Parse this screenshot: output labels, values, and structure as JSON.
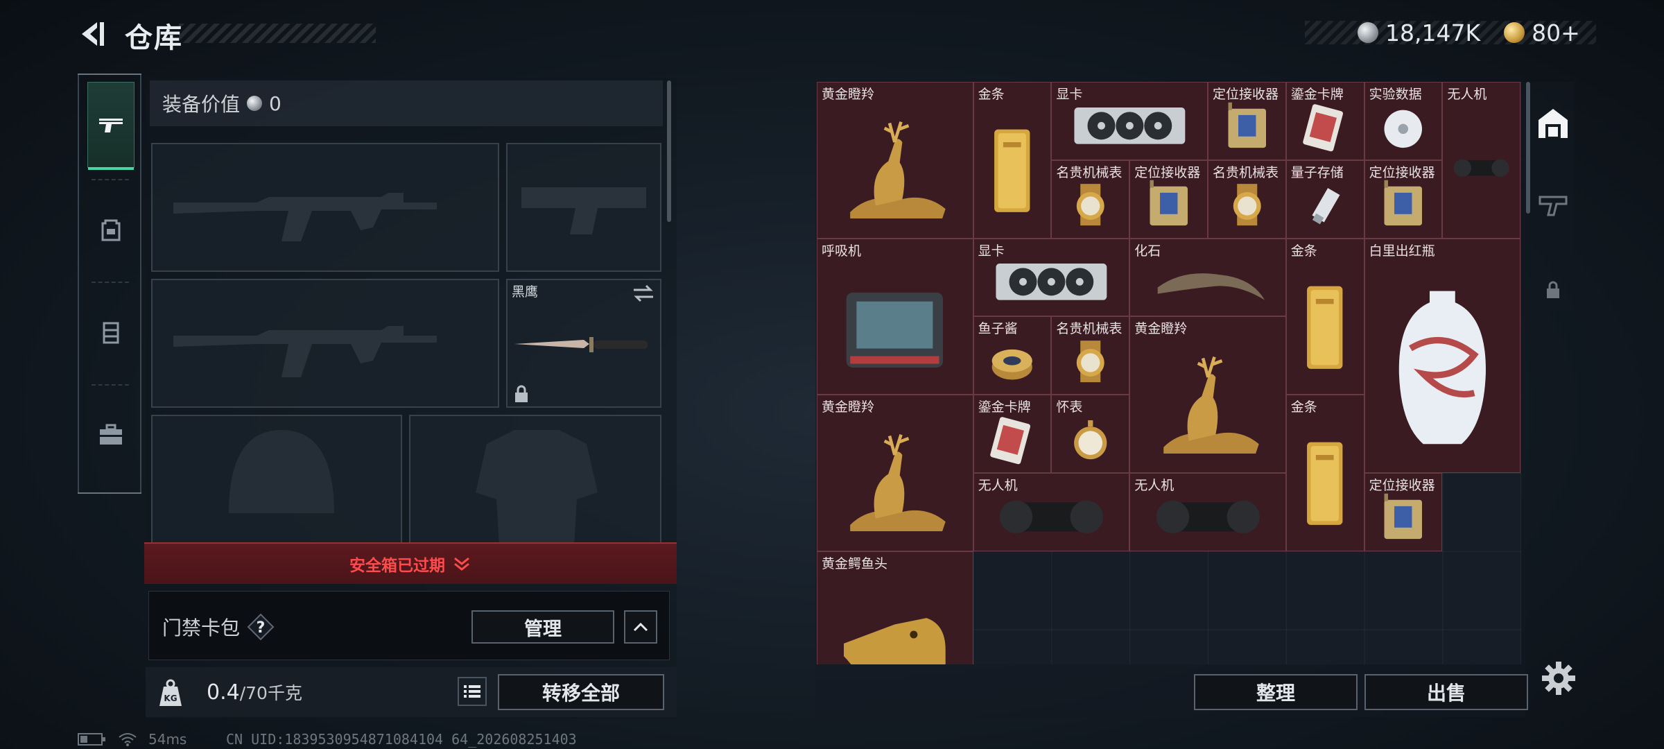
{
  "header": {
    "title": "仓库",
    "currency": [
      {
        "icon": "silver-coin-icon",
        "value": "18,147K"
      },
      {
        "icon": "gold-coin-icon",
        "value": "80+"
      }
    ]
  },
  "equipment": {
    "value_label": "装备价值",
    "value": "0",
    "melee_name": "黑鹰",
    "safebox_status": "安全箱已过期",
    "keycard_label": "门禁卡包",
    "manage_label": "管理",
    "weight_current": "0.4",
    "weight_capacity": "/70千克",
    "transfer_all_label": "转移全部"
  },
  "tabs": [
    "gun-icon",
    "backpack-icon",
    "chest-rig-icon",
    "toolbox-icon"
  ],
  "storage": {
    "items": [
      {
        "name": "黄金瞪羚",
        "icon": "golden-gazelle"
      },
      {
        "name": "金条",
        "icon": "gold-bar"
      },
      {
        "name": "显卡",
        "icon": "graphics-card"
      },
      {
        "name": "定位接收器",
        "icon": "locator-receiver"
      },
      {
        "name": "鎏金卡牌",
        "icon": "gilded-card"
      },
      {
        "name": "实验数据",
        "icon": "data-disc"
      },
      {
        "name": "无人机",
        "icon": "drone"
      },
      {
        "name": "名贵机械表",
        "icon": "luxury-watch"
      },
      {
        "name": "定位接收器",
        "icon": "locator-receiver"
      },
      {
        "name": "名贵机械表",
        "icon": "luxury-watch"
      },
      {
        "name": "量子存储",
        "icon": "quantum-storage"
      },
      {
        "name": "定位接收器",
        "icon": "locator-receiver"
      },
      {
        "name": "呼吸机",
        "icon": "ventilator"
      },
      {
        "name": "显卡",
        "icon": "graphics-card"
      },
      {
        "name": "化石",
        "icon": "fossil"
      },
      {
        "name": "金条",
        "icon": "gold-bar"
      },
      {
        "name": "白里出红瓶",
        "icon": "porcelain-vase"
      },
      {
        "name": "鱼子酱",
        "icon": "caviar-tin"
      },
      {
        "name": "名贵机械表",
        "icon": "luxury-watch"
      },
      {
        "name": "黄金瞪羚",
        "icon": "golden-gazelle"
      },
      {
        "name": "黄金瞪羚",
        "icon": "golden-gazelle"
      },
      {
        "name": "鎏金卡牌",
        "icon": "gilded-card"
      },
      {
        "name": "怀表",
        "icon": "pocket-watch"
      },
      {
        "name": "金条",
        "icon": "gold-bar"
      },
      {
        "name": "无人机",
        "icon": "drone"
      },
      {
        "name": "无人机",
        "icon": "drone"
      },
      {
        "name": "定位接收器",
        "icon": "locator-receiver"
      },
      {
        "name": "黄金鳄鱼头",
        "icon": "golden-crocodile-head"
      }
    ],
    "sort_label": "整理",
    "sell_label": "出售"
  },
  "status": {
    "ping": "54ms",
    "uid": "CN UID:1839530954871084104 64_202608251403"
  }
}
